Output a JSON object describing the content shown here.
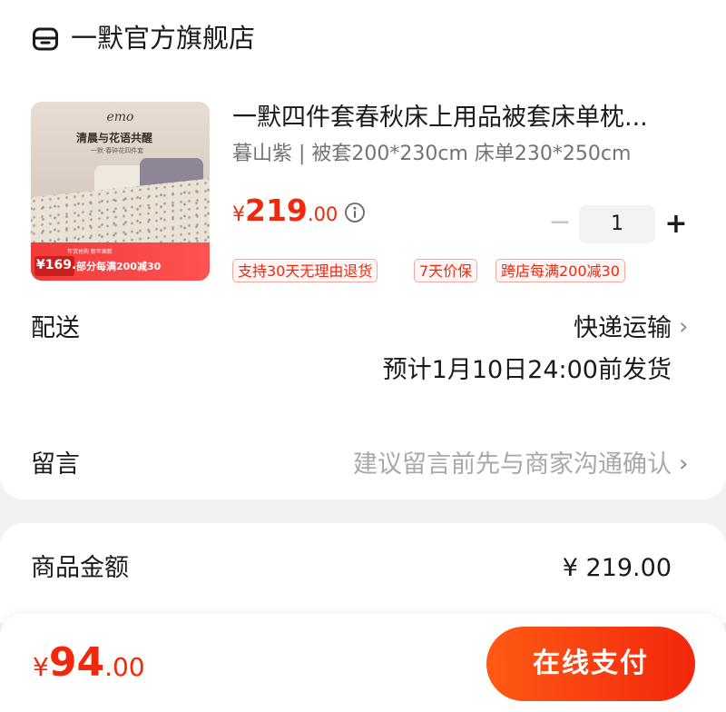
{
  "store": {
    "name": "一默官方旗舰店",
    "icon": "shop-icon"
  },
  "product": {
    "title": "一默四件套春秋床上用品被套床单枕...",
    "spec": "暮山紫 | 被套200*230cm 床单230*250cm",
    "price_symbol": "¥",
    "price_int": "219",
    "price_dec": ".00",
    "quantity": "1",
    "minus_label": "−",
    "plus_label": "+",
    "tags": [
      "支持30天无理由退货",
      "7天价保",
      "跨店每满200减30"
    ],
    "image_text": {
      "brand": "emo",
      "slogan": "清晨与花语共醒",
      "subslogan": "一默·春碎花四件套",
      "promo_top": "年货抢购 新年焕新",
      "promo_price": "¥169.",
      "promo_text": "部分每满200减30"
    }
  },
  "delivery": {
    "label": "配送",
    "method": "快递运输",
    "eta": "预计1月10日24:00前发货"
  },
  "note": {
    "label": "留言",
    "placeholder": "建议留言前先与商家沟通确认"
  },
  "amount": {
    "label": "商品金额",
    "value": "¥ 219.00"
  },
  "footer": {
    "total_symbol": "¥",
    "total_int": "94",
    "total_dec": ".00",
    "pay_label": "在线支付"
  },
  "colors": {
    "accent": "#f2270c",
    "pay_gradient_start": "#ff5a14",
    "tag_border": "#f2a8a0",
    "muted_text": "#a8a8a8"
  }
}
